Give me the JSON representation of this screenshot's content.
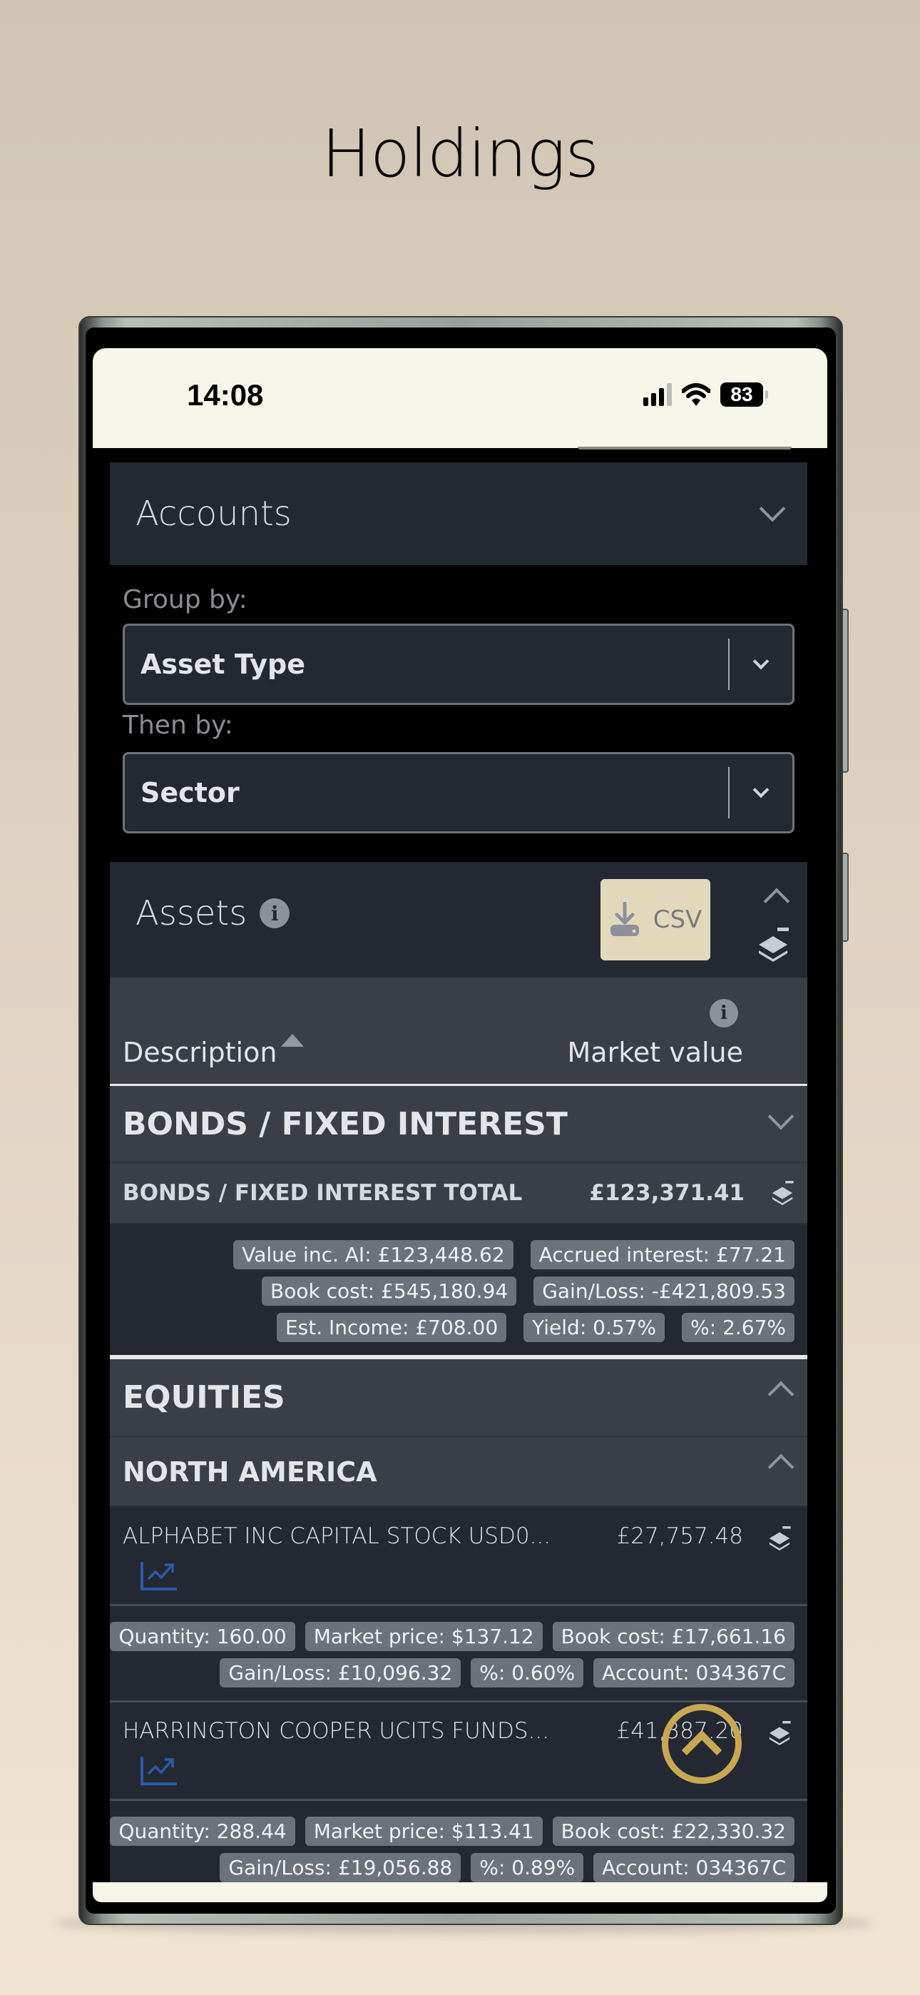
{
  "page_title": "Holdings",
  "status_bar": {
    "time": "14:08",
    "battery": "83"
  },
  "accounts": {
    "title": "Accounts"
  },
  "grouping": {
    "group_by_label": "Group by:",
    "group_by_value": "Asset Type",
    "then_by_label": "Then by:",
    "then_by_value": "Sector"
  },
  "assets": {
    "title": "Assets",
    "csv_label": "CSV",
    "columns": {
      "description": "Description",
      "market_value": "Market value"
    }
  },
  "groups": [
    {
      "name": "BONDS / FIXED INTEREST",
      "expanded": false,
      "total_label": "BONDS / FIXED INTEREST TOTAL",
      "total_value": "£123,371.41",
      "chips": [
        [
          "Value inc. AI: £123,448.62",
          "Accrued interest: £77.21"
        ],
        [
          "Book cost: £545,180.94",
          "Gain/Loss: -£421,809.53"
        ],
        [
          "Est. Income: £708.00",
          "Yield: 0.57%",
          "%: 2.67%"
        ]
      ]
    },
    {
      "name": "EQUITIES",
      "expanded": true,
      "subgroups": [
        {
          "name": "NORTH AMERICA",
          "expanded": true,
          "holdings": [
            {
              "name": "ALPHABET INC CAPITAL STOCK USD0...",
              "value": "£27,757.48",
              "chips": [
                [
                  "Quantity: 160.00",
                  "Market price: $137.12",
                  "Book cost: £17,661.16"
                ],
                [
                  "Gain/Loss: £10,096.32",
                  "%: 0.60%",
                  "Account: 034367C"
                ]
              ]
            },
            {
              "name": "HARRINGTON COOPER UCITS FUNDS...",
              "value": "£41,387.20",
              "chips": [
                [
                  "Quantity: 288.44",
                  "Market price: $113.41",
                  "Book cost: £22,330.32"
                ],
                [
                  "Gain/Loss: £19,056.88",
                  "%: 0.89%",
                  "Account: 034367C"
                ]
              ]
            }
          ]
        }
      ]
    }
  ],
  "colors": {
    "accent_gold": "#c9a853",
    "csv_button": "#e2d9bd",
    "panel_dark": "#232833",
    "panel_header": "#3a3e47",
    "chip": "#6b727c",
    "chart_icon": "#2b5aa8"
  }
}
